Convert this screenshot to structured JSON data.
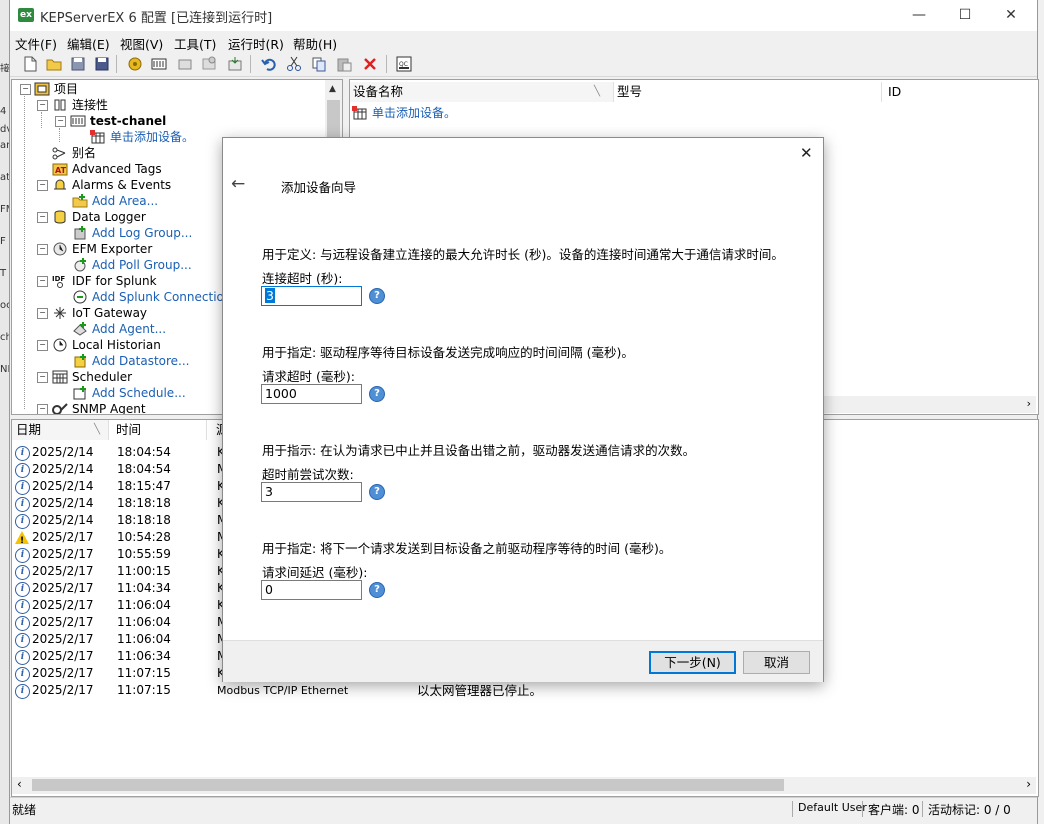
{
  "window": {
    "logo": "ex",
    "title": "KEPServerEX 6 配置 [已连接到运行时]",
    "controls": {
      "minimize": "—",
      "maximize": "☐",
      "close": "✕"
    }
  },
  "left_peek": [
    "接",
    "4",
    "dv",
    "an",
    "at",
    "FM",
    "F",
    "T",
    "oc",
    "ch",
    "NM"
  ],
  "menu": [
    "文件(F)",
    "编辑(E)",
    "视图(V)",
    "工具(T)",
    "运行时(R)",
    "帮助(H)"
  ],
  "toolbar": [
    "new-file-icon",
    "open-folder-icon",
    "save-icon",
    "save-as-icon",
    "connect-icon",
    "new-channel-icon",
    "new-device-icon",
    "properties-icon",
    "import-icon",
    "undo-icon",
    "cut-icon",
    "copy-icon",
    "paste-icon",
    "delete-icon",
    "quick-client-icon"
  ],
  "tree": {
    "project": "项目",
    "connectivity": "连接性",
    "channel": "test-chanel",
    "add_device": "单击添加设备。",
    "aliases": "别名",
    "advanced_tags": "Advanced Tags",
    "alarms": "Alarms & Events",
    "add_area": "Add Area...",
    "data_logger": "Data Logger",
    "add_log_group": "Add Log Group...",
    "efm": "EFM Exporter",
    "add_poll_group": "Add Poll Group...",
    "idf": "IDF for Splunk",
    "add_splunk": "Add Splunk Connection...",
    "iot": "IoT Gateway",
    "add_agent": "Add Agent...",
    "historian": "Local Historian",
    "add_datastore": "Add Datastore...",
    "scheduler": "Scheduler",
    "add_schedule": "Add Schedule...",
    "snmp": "SNMP Agent"
  },
  "device_list": {
    "columns": [
      "设备名称",
      "型号",
      "ID"
    ],
    "add_device": "单击添加设备。"
  },
  "log": {
    "columns": [
      "日期",
      "时间",
      "源"
    ],
    "rows": [
      {
        "icon": "info",
        "date": "2025/2/14",
        "time": "18:04:54",
        "source": "K",
        "event": ""
      },
      {
        "icon": "info",
        "date": "2025/2/14",
        "time": "18:04:54",
        "source": "M",
        "event": ""
      },
      {
        "icon": "info",
        "date": "2025/2/14",
        "time": "18:15:47",
        "source": "K",
        "event": ""
      },
      {
        "icon": "info",
        "date": "2025/2/14",
        "time": "18:18:18",
        "source": "K",
        "event": ""
      },
      {
        "icon": "info",
        "date": "2025/2/14",
        "time": "18:18:18",
        "source": "M",
        "event": ""
      },
      {
        "icon": "warning",
        "date": "2025/2/17",
        "time": "10:54:28",
        "source": "M",
        "event": ""
      },
      {
        "icon": "info",
        "date": "2025/2/17",
        "time": "10:55:59",
        "source": "K",
        "event": ""
      },
      {
        "icon": "info",
        "date": "2025/2/17",
        "time": "11:00:15",
        "source": "K",
        "event": ""
      },
      {
        "icon": "info",
        "date": "2025/2/17",
        "time": "11:04:34",
        "source": "K",
        "event": ""
      },
      {
        "icon": "info",
        "date": "2025/2/17",
        "time": "11:06:04",
        "source": "K",
        "event": ""
      },
      {
        "icon": "info",
        "date": "2025/2/17",
        "time": "11:06:04",
        "source": "M",
        "event": ""
      },
      {
        "icon": "info",
        "date": "2025/2/17",
        "time": "11:06:04",
        "source": "M",
        "event": ""
      },
      {
        "icon": "info",
        "date": "2025/2/17",
        "time": "11:06:34",
        "source": "M",
        "event": ""
      },
      {
        "icon": "info",
        "date": "2025/2/17",
        "time": "11:07:15",
        "source": "K",
        "event": ""
      },
      {
        "icon": "info",
        "date": "2025/2/17",
        "time": "11:07:15",
        "source": "Modbus TCP/IP Ethernet",
        "event": "以太网管理器已停止。"
      }
    ]
  },
  "status": {
    "ready": "就绪",
    "user": "Default User",
    "clients": "客户端: 0",
    "active_tags": "活动标记: 0 / 0"
  },
  "dialog": {
    "close": "✕",
    "back": "←",
    "title": "添加设备向导",
    "fields": [
      {
        "desc": "用于定义: 与远程设备建立连接的最大允许时长 (秒)。设备的连接时间通常大于通信请求时间。",
        "label": "连接超时 (秒):",
        "value": "3"
      },
      {
        "desc": "用于指定: 驱动程序等待目标设备发送完成响应的时间间隔 (毫秒)。",
        "label": "请求超时 (毫秒):",
        "value": "1000"
      },
      {
        "desc": "用于指示: 在认为请求已中止并且设备出错之前，驱动器发送通信请求的次数。",
        "label": "超时前尝试次数:",
        "value": "3"
      },
      {
        "desc": "用于指定: 将下一个请求发送到目标设备之前驱动程序等待的时间 (毫秒)。",
        "label": "请求间延迟 (毫秒):",
        "value": "0"
      }
    ],
    "next": "下一步(N)",
    "cancel": "取消"
  },
  "colors": {
    "link": "#1a5fb4",
    "accent": "#0078d7",
    "help": "#4f8fd6",
    "logo": "#2e8a3e"
  }
}
